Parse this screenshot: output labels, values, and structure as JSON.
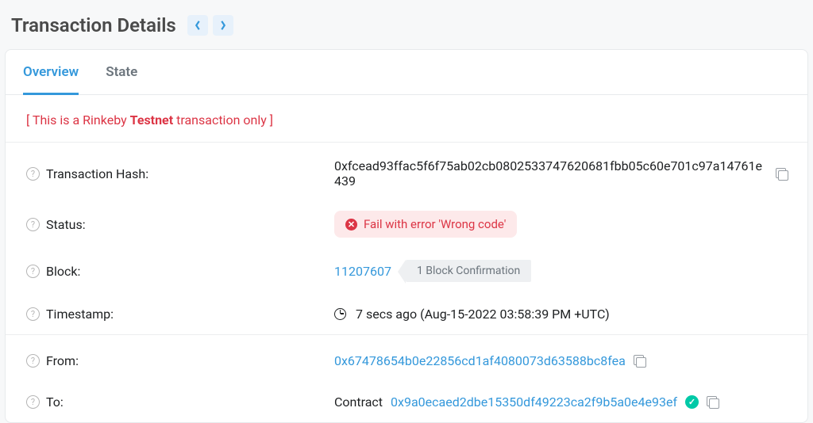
{
  "header": {
    "title": "Transaction Details"
  },
  "tabs": {
    "overview": "Overview",
    "state": "State"
  },
  "notice": {
    "pre": "[ This is a Rinkeby ",
    "bold": "Testnet",
    "post": " transaction only ]"
  },
  "labels": {
    "hash": "Transaction Hash:",
    "status": "Status:",
    "block": "Block:",
    "timestamp": "Timestamp:",
    "from": "From:",
    "to": "To:"
  },
  "tx": {
    "hash": "0xfcead93ffac5f6f75ab02cb0802533747620681fbb05c60e701c97a14761e439",
    "status_text": "Fail with error 'Wrong code'",
    "block": "11207607",
    "confirmations": "1 Block Confirmation",
    "timestamp": "7 secs ago (Aug-15-2022 03:58:39 PM +UTC)",
    "from": "0x67478654b0e22856cd1af4080073d63588bc8fea",
    "to_prefix": "Contract ",
    "to": "0x9a0ecaed2dbe15350df49223ca2f9b5a0e4e93ef"
  }
}
